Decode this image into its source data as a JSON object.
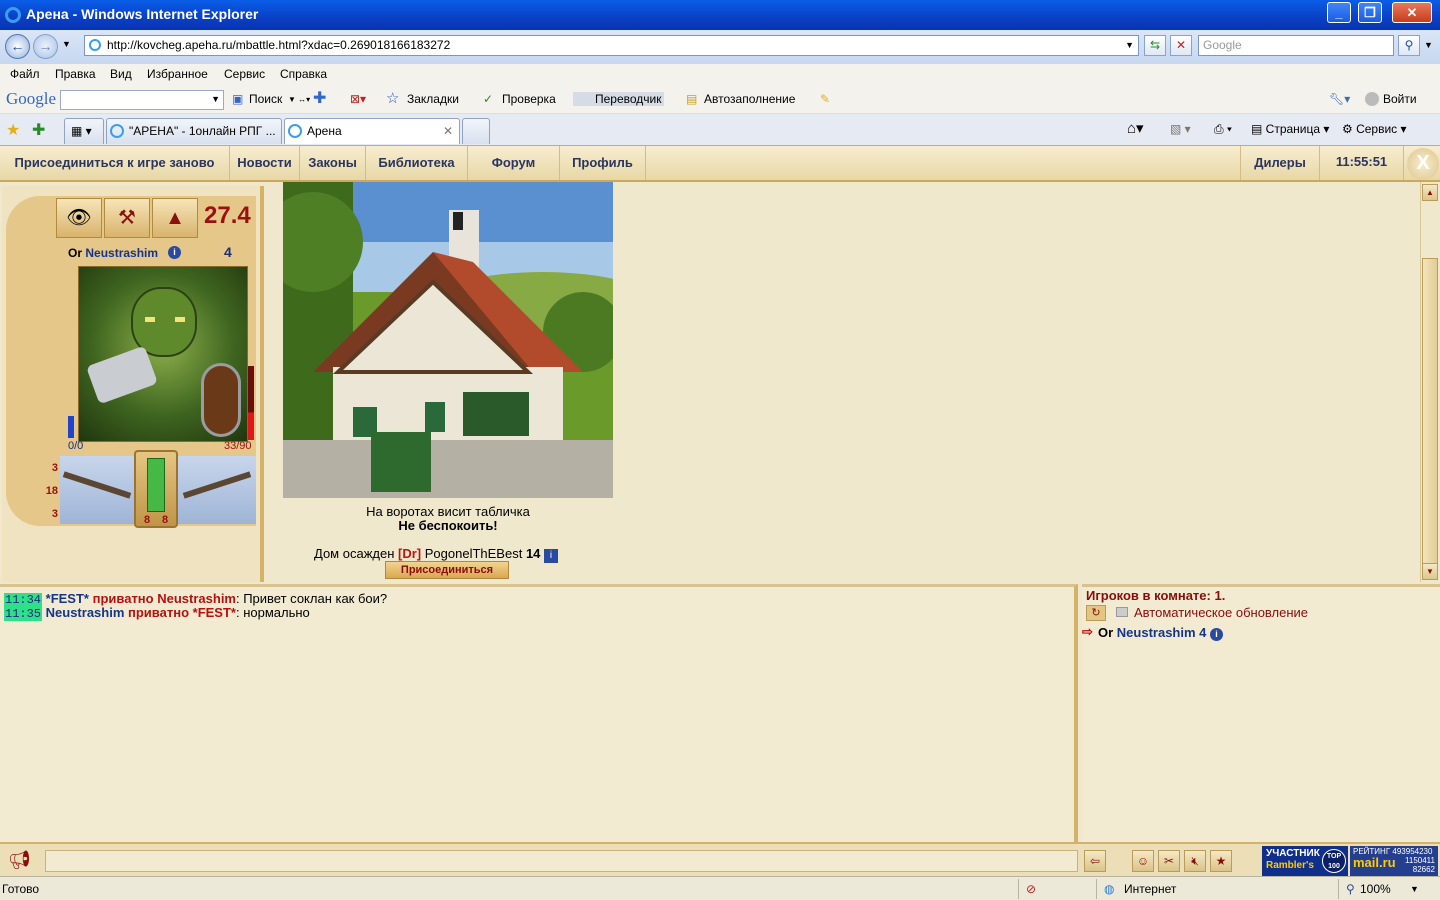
{
  "window": {
    "title": "Арена - Windows Internet Explorer"
  },
  "address": {
    "url": "http://kovcheg.apeha.ru/mbattle.html?xdac=0.269018166183272",
    "search_placeholder": "Google"
  },
  "menu": [
    "Файл",
    "Правка",
    "Вид",
    "Избранное",
    "Сервис",
    "Справка"
  ],
  "google_toolbar": {
    "logo": "Google",
    "search": "Поиск",
    "bookmarks": "Закладки",
    "check": "Проверка",
    "translator": "Переводчик",
    "autofill": "Автозаполнение",
    "signin": "Войти"
  },
  "tabs": [
    {
      "label": "\"АРЕНА\" - 1онлайн РПГ ..."
    },
    {
      "label": "Арена"
    }
  ],
  "command_bar": {
    "page": "Страница",
    "tools": "Сервис"
  },
  "game_menu": {
    "rejoin": "Присоединиться к игре заново",
    "news": "Новости",
    "laws": "Законы",
    "library": "Библиотека",
    "forum": "Форум",
    "profile": "Профиль",
    "dealers": "Дилеры",
    "time": "11:55:51",
    "close": "X"
  },
  "character": {
    "big_value": "27.4",
    "race": "Or",
    "name": "Neustrashim",
    "level": "4",
    "mana": "0/0",
    "health": "33/90",
    "health_fraction": 0.37,
    "side_stats": [
      "3",
      "18",
      "3"
    ],
    "equip_stats": [
      "8",
      "8"
    ]
  },
  "house": {
    "caption_line1": "На воротах висит табличка",
    "caption_line2": "Не беспокоить!",
    "siege_prefix": "Дом осажден",
    "clan_tag": "[Dr]",
    "attacker": "PogonelThEBest",
    "attacker_level": "14",
    "join_button": "Присоединиться"
  },
  "chat": [
    {
      "time": "11:34",
      "from": "*FEST*",
      "mode": "приватно",
      "to": "Neustrashim",
      "text": ": Привет соклан как бои?"
    },
    {
      "time": "11:35",
      "from": "Neustrashim",
      "mode": "приватно",
      "to": "*FEST*",
      "text": ": нормально"
    }
  ],
  "players": {
    "header": "Игроков в комнате: 1.",
    "auto_update": "Автоматическое обновление",
    "list": [
      {
        "race": "Or",
        "name": "Neustrashim",
        "level": "4"
      }
    ]
  },
  "counters": {
    "rambler_line1": "УЧАСТНИК",
    "rambler_line2": "Rambler's",
    "rambler_badge": "TOP 100",
    "mailru_brand": "mail.ru",
    "mailru_label": "РЕЙТИНГ",
    "mailru_values": [
      "493954230",
      "1150411",
      "82662"
    ]
  },
  "status": {
    "ready": "Готово",
    "zone": "Интернет",
    "zoom": "100%"
  },
  "colors": {
    "accent_red": "#b8100e",
    "accent_blue": "#15358a",
    "panel": "#f0e8cc",
    "timestamp": "#2ee08a"
  }
}
